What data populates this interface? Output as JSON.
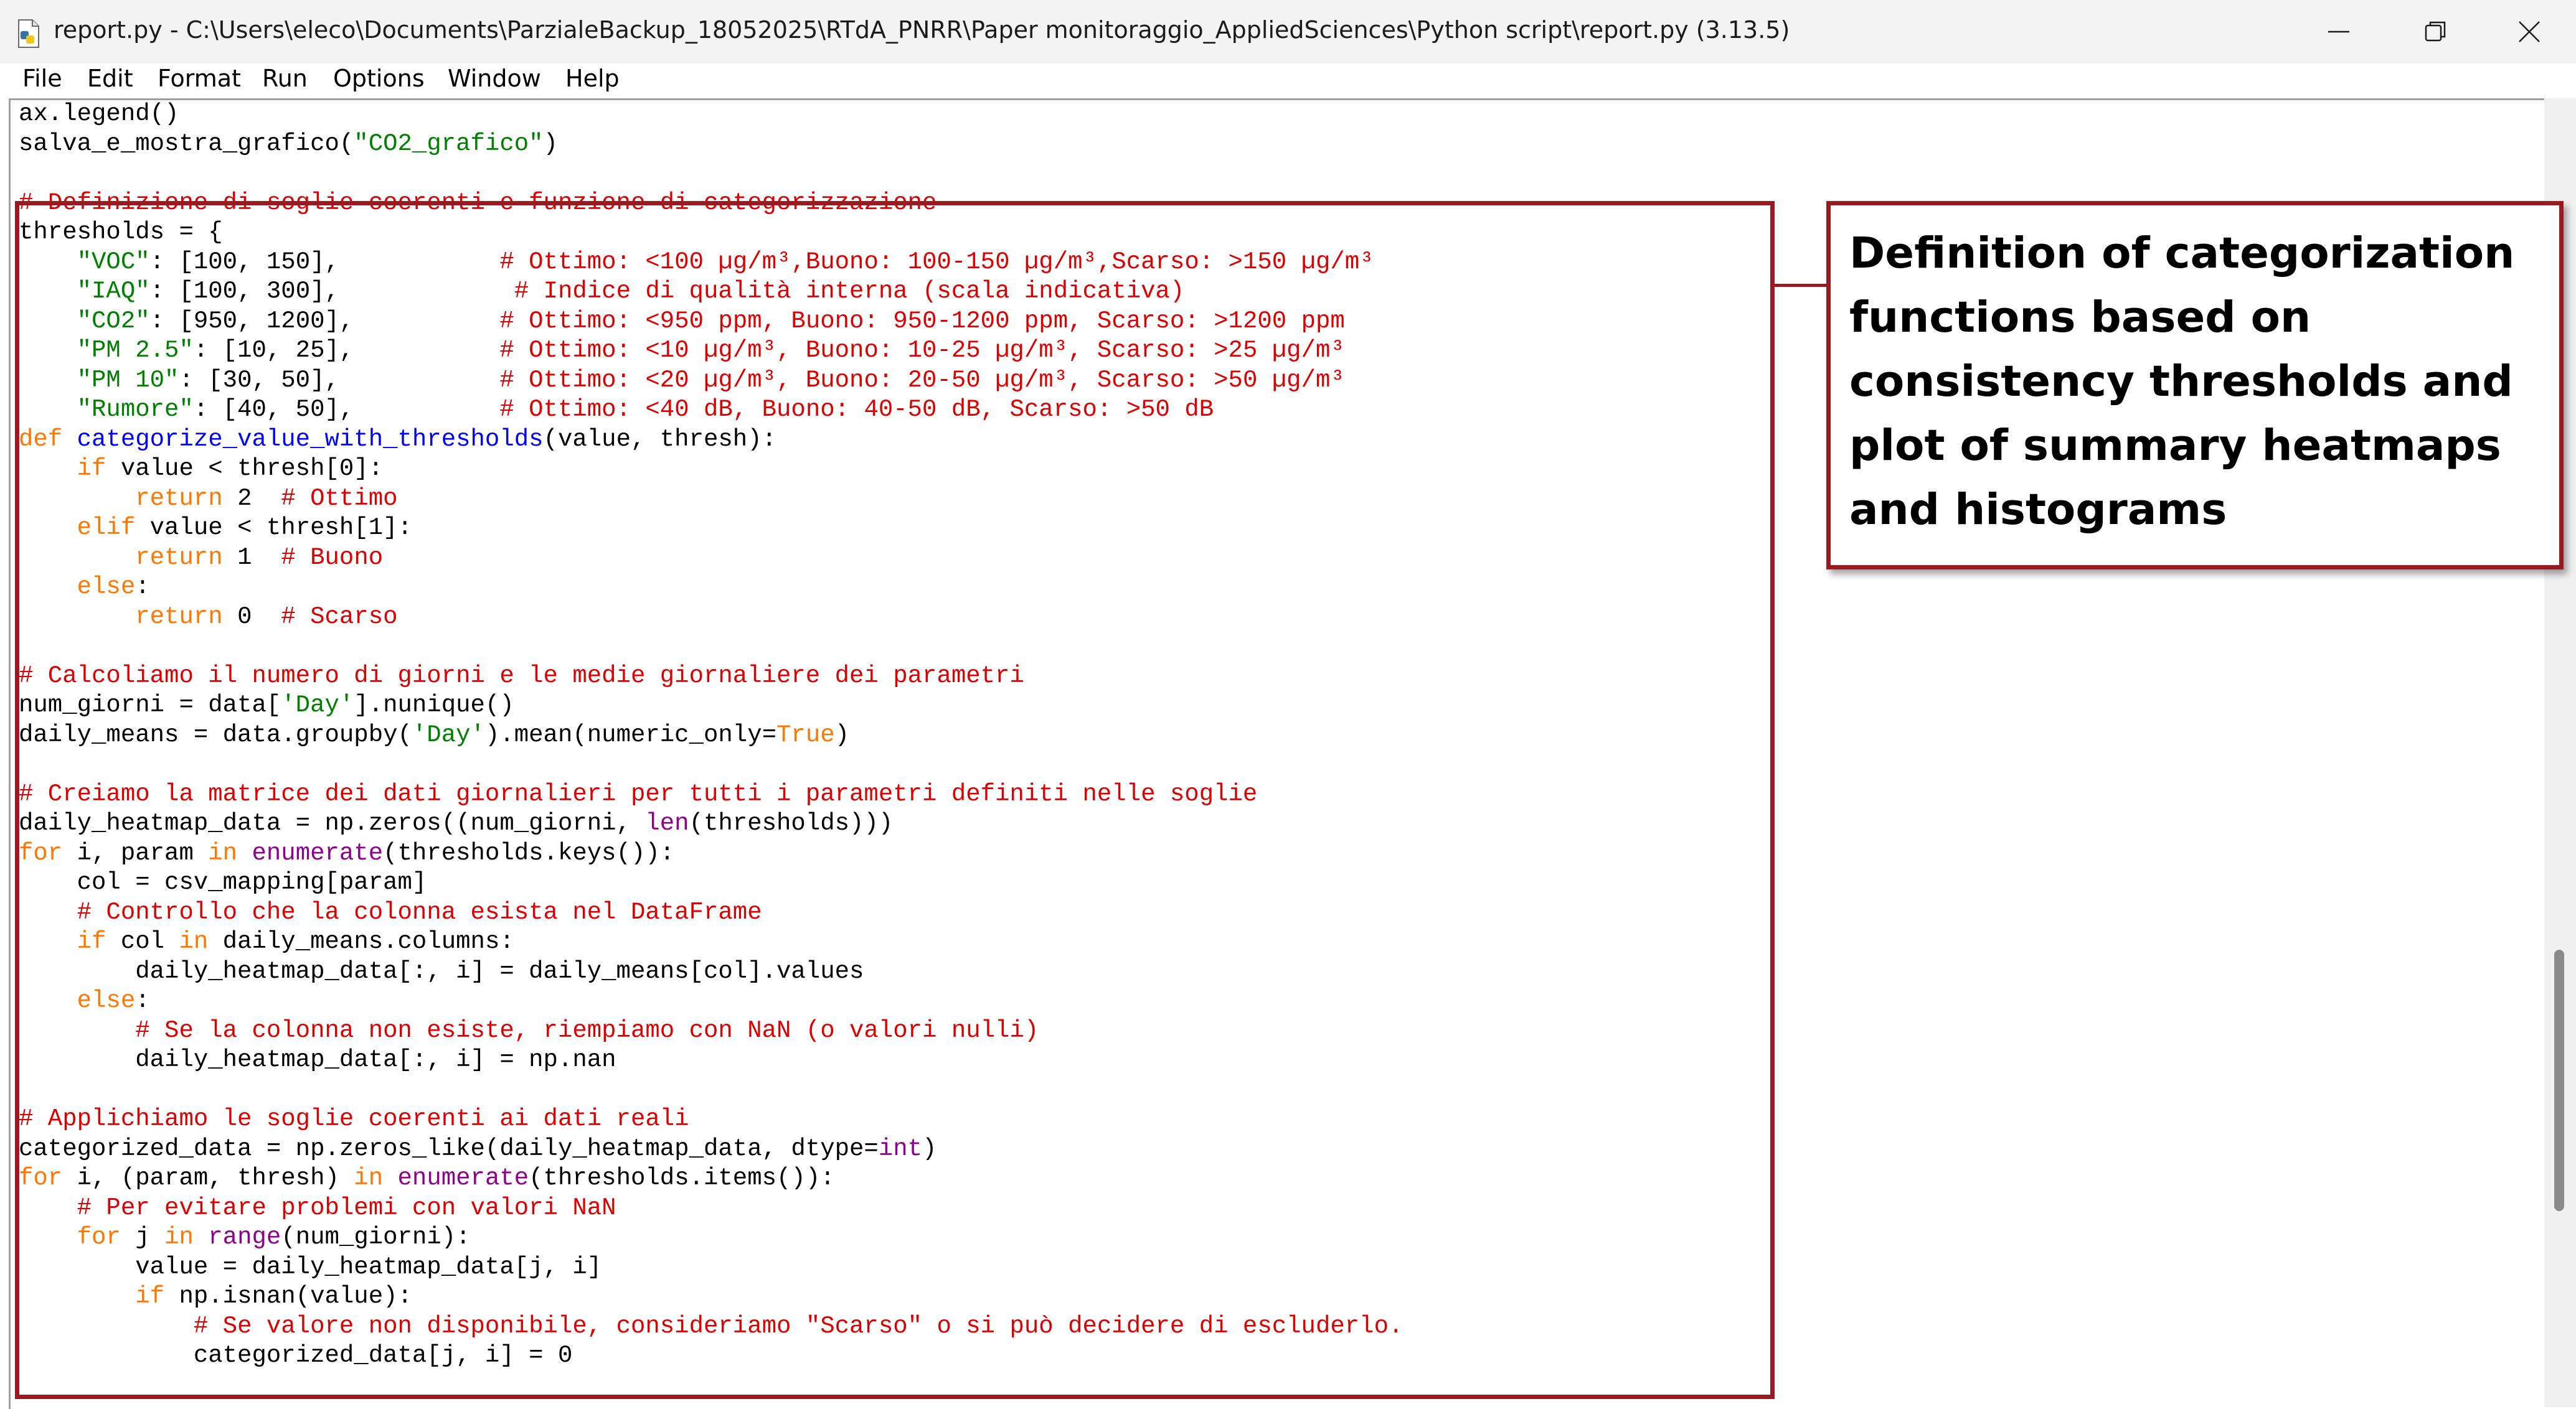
{
  "window": {
    "title": "report.py - C:\\Users\\eleco\\Documents\\ParzialeBackup_18052025\\RTdA_PNRR\\Paper monitoraggio_AppliedSciences\\Python script\\report.py (3.13.5)",
    "icon": "python-file-icon",
    "controls": [
      "minimize-icon",
      "maximize-icon",
      "close-icon"
    ]
  },
  "menu": {
    "file": "File",
    "edit": "Edit",
    "format": "Format",
    "run": "Run",
    "options": "Options",
    "window": "Window",
    "help": "Help"
  },
  "colors": {
    "comment": "#dd0000",
    "string": "#008000",
    "keyword": "#ff7700",
    "builtin": "#900090",
    "definition": "#0000ff",
    "highlight_border": "#9a1a22"
  },
  "code_lines": [
    [
      {
        "t": "ax.legend()"
      }
    ],
    [
      {
        "t": "salva_e_mostra_grafico("
      },
      {
        "t": "\"CO2_grafico\"",
        "c": "s"
      },
      {
        "t": ")"
      }
    ],
    [
      {
        "t": ""
      }
    ],
    [
      {
        "t": "# Definizione di soglie coerenti e funzione di categorizzazione",
        "c": "c"
      }
    ],
    [
      {
        "t": "thresholds = {"
      }
    ],
    [
      {
        "t": "    "
      },
      {
        "t": "\"VOC\"",
        "c": "s"
      },
      {
        "t": ": [100, 150],           "
      },
      {
        "t": "# Ottimo: <100 µg/m³,Buono: 100-150 µg/m³,Scarso: >150 µg/m³",
        "c": "c"
      }
    ],
    [
      {
        "t": "    "
      },
      {
        "t": "\"IAQ\"",
        "c": "s"
      },
      {
        "t": ": [100, 300],            "
      },
      {
        "t": "# Indice di qualità interna (scala indicativa)",
        "c": "c"
      }
    ],
    [
      {
        "t": "    "
      },
      {
        "t": "\"CO2\"",
        "c": "s"
      },
      {
        "t": ": [950, 1200],          "
      },
      {
        "t": "# Ottimo: <950 ppm, Buono: 950-1200 ppm, Scarso: >1200 ppm",
        "c": "c"
      }
    ],
    [
      {
        "t": "    "
      },
      {
        "t": "\"PM 2.5\"",
        "c": "s"
      },
      {
        "t": ": [10, 25],          "
      },
      {
        "t": "# Ottimo: <10 µg/m³, Buono: 10-25 µg/m³, Scarso: >25 µg/m³",
        "c": "c"
      }
    ],
    [
      {
        "t": "    "
      },
      {
        "t": "\"PM 10\"",
        "c": "s"
      },
      {
        "t": ": [30, 50],           "
      },
      {
        "t": "# Ottimo: <20 µg/m³, Buono: 20-50 µg/m³, Scarso: >50 µg/m³",
        "c": "c"
      }
    ],
    [
      {
        "t": "    "
      },
      {
        "t": "\"Rumore\"",
        "c": "s"
      },
      {
        "t": ": [40, 50],          "
      },
      {
        "t": "# Ottimo: <40 dB, Buono: 40-50 dB, Scarso: >50 dB",
        "c": "c"
      }
    ],
    [
      {
        "t": "def ",
        "c": "k"
      },
      {
        "t": "categorize_value_with_thresholds",
        "c": "f"
      },
      {
        "t": "(value, thresh):"
      }
    ],
    [
      {
        "t": "    "
      },
      {
        "t": "if",
        "c": "k"
      },
      {
        "t": " value < thresh[0]:"
      }
    ],
    [
      {
        "t": "        "
      },
      {
        "t": "return",
        "c": "k"
      },
      {
        "t": " 2  "
      },
      {
        "t": "# Ottimo",
        "c": "c"
      }
    ],
    [
      {
        "t": "    "
      },
      {
        "t": "elif",
        "c": "k"
      },
      {
        "t": " value < thresh[1]:"
      }
    ],
    [
      {
        "t": "        "
      },
      {
        "t": "return",
        "c": "k"
      },
      {
        "t": " 1  "
      },
      {
        "t": "# Buono",
        "c": "c"
      }
    ],
    [
      {
        "t": "    "
      },
      {
        "t": "else",
        "c": "k"
      },
      {
        "t": ":"
      }
    ],
    [
      {
        "t": "        "
      },
      {
        "t": "return",
        "c": "k"
      },
      {
        "t": " 0  "
      },
      {
        "t": "# Scarso",
        "c": "c"
      }
    ],
    [
      {
        "t": ""
      }
    ],
    [
      {
        "t": "# Calcoliamo il numero di giorni e le medie giornaliere dei parametri",
        "c": "c"
      }
    ],
    [
      {
        "t": "num_giorni = data["
      },
      {
        "t": "'Day'",
        "c": "s"
      },
      {
        "t": "].nunique()"
      }
    ],
    [
      {
        "t": "daily_means = data.groupby("
      },
      {
        "t": "'Day'",
        "c": "s"
      },
      {
        "t": ").mean(numeric_only="
      },
      {
        "t": "True",
        "c": "k"
      },
      {
        "t": ")"
      }
    ],
    [
      {
        "t": ""
      }
    ],
    [
      {
        "t": "# Creiamo la matrice dei dati giornalieri per tutti i parametri definiti nelle soglie",
        "c": "c"
      }
    ],
    [
      {
        "t": "daily_heatmap_data = np.zeros((num_giorni, "
      },
      {
        "t": "len",
        "c": "b"
      },
      {
        "t": "(thresholds)))"
      }
    ],
    [
      {
        "t": "for",
        "c": "k"
      },
      {
        "t": " i, param "
      },
      {
        "t": "in",
        "c": "k"
      },
      {
        "t": " "
      },
      {
        "t": "enumerate",
        "c": "b"
      },
      {
        "t": "(thresholds.keys()):"
      }
    ],
    [
      {
        "t": "    col = csv_mapping[param]"
      }
    ],
    [
      {
        "t": "    "
      },
      {
        "t": "# Controllo che la colonna esista nel DataFrame",
        "c": "c"
      }
    ],
    [
      {
        "t": "    "
      },
      {
        "t": "if",
        "c": "k"
      },
      {
        "t": " col "
      },
      {
        "t": "in",
        "c": "k"
      },
      {
        "t": " daily_means.columns:"
      }
    ],
    [
      {
        "t": "        daily_heatmap_data[:, i] = daily_means[col].values"
      }
    ],
    [
      {
        "t": "    "
      },
      {
        "t": "else",
        "c": "k"
      },
      {
        "t": ":"
      }
    ],
    [
      {
        "t": "        "
      },
      {
        "t": "# Se la colonna non esiste, riempiamo con NaN (o valori nulli)",
        "c": "c"
      }
    ],
    [
      {
        "t": "        daily_heatmap_data[:, i] = np.nan"
      }
    ],
    [
      {
        "t": ""
      }
    ],
    [
      {
        "t": "# Applichiamo le soglie coerenti ai dati reali",
        "c": "c"
      }
    ],
    [
      {
        "t": "categorized_data = np.zeros_like(daily_heatmap_data, dtype="
      },
      {
        "t": "int",
        "c": "b"
      },
      {
        "t": ")"
      }
    ],
    [
      {
        "t": "for",
        "c": "k"
      },
      {
        "t": " i, (param, thresh) "
      },
      {
        "t": "in",
        "c": "k"
      },
      {
        "t": " "
      },
      {
        "t": "enumerate",
        "c": "b"
      },
      {
        "t": "(thresholds.items()):"
      }
    ],
    [
      {
        "t": "    "
      },
      {
        "t": "# Per evitare problemi con valori NaN",
        "c": "c"
      }
    ],
    [
      {
        "t": "    "
      },
      {
        "t": "for",
        "c": "k"
      },
      {
        "t": " j "
      },
      {
        "t": "in",
        "c": "k"
      },
      {
        "t": " "
      },
      {
        "t": "range",
        "c": "b"
      },
      {
        "t": "(num_giorni):"
      }
    ],
    [
      {
        "t": "        value = daily_heatmap_data[j, i]"
      }
    ],
    [
      {
        "t": "        "
      },
      {
        "t": "if",
        "c": "k"
      },
      {
        "t": " np.isnan(value):"
      }
    ],
    [
      {
        "t": "            "
      },
      {
        "t": "# Se valore non disponibile, consideriamo \"Scarso\" o si può decidere di escluderlo.",
        "c": "c"
      }
    ],
    [
      {
        "t": "            categorized_data[j, i] = 0"
      }
    ]
  ],
  "annotation": {
    "text": "Definition of categorization functions based on consistency thresholds and plot of summary heatmaps and histograms"
  }
}
